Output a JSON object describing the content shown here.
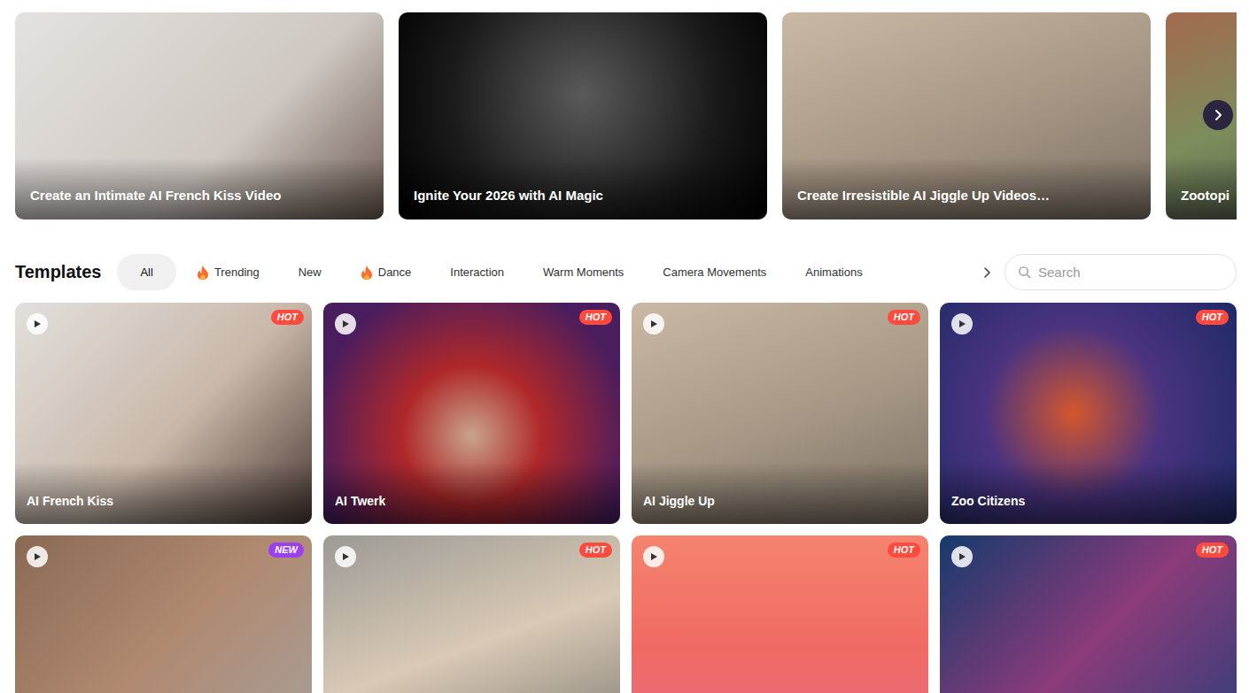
{
  "banners": [
    {
      "title": "Create an Intimate AI French Kiss Video"
    },
    {
      "title": "Ignite Your 2026 with AI Magic"
    },
    {
      "title": "Create Irresistible AI Jiggle Up Videos…"
    },
    {
      "title": "Zootopi"
    }
  ],
  "templates": {
    "title": "Templates",
    "tabs": [
      {
        "label": "All",
        "selected": true,
        "kind": "plain"
      },
      {
        "label": "Trending",
        "selected": false,
        "kind": "hot"
      },
      {
        "label": "New",
        "selected": false,
        "kind": "plain"
      },
      {
        "label": "Dance",
        "selected": false,
        "kind": "hot"
      },
      {
        "label": "Interaction",
        "selected": false,
        "kind": "plain"
      },
      {
        "label": "Warm Moments",
        "selected": false,
        "kind": "plain"
      },
      {
        "label": "Camera Movements",
        "selected": false,
        "kind": "plain"
      },
      {
        "label": "Animations",
        "selected": false,
        "kind": "plain"
      }
    ],
    "search": {
      "placeholder": "Search"
    }
  },
  "cards": [
    {
      "title": "AI French Kiss",
      "badge": {
        "text": "HOT",
        "color": "#ff4a3d"
      }
    },
    {
      "title": "AI Twerk",
      "badge": {
        "text": "HOT",
        "color": "#ff4a3d"
      }
    },
    {
      "title": "AI Jiggle Up",
      "badge": {
        "text": "HOT",
        "color": "#ff4a3d"
      }
    },
    {
      "title": "Zoo Citizens",
      "badge": {
        "text": "HOT",
        "color": "#ff4a3d"
      }
    },
    {
      "title": "",
      "badge": {
        "text": "NEW",
        "color": "#9b3ff0"
      }
    },
    {
      "title": "",
      "badge": {
        "text": "HOT",
        "color": "#ff4a3d"
      }
    },
    {
      "title": "",
      "badge": {
        "text": "HOT",
        "color": "#ff4a3d"
      }
    },
    {
      "title": "",
      "badge": {
        "text": "HOT",
        "color": "#ff4a3d"
      }
    }
  ]
}
